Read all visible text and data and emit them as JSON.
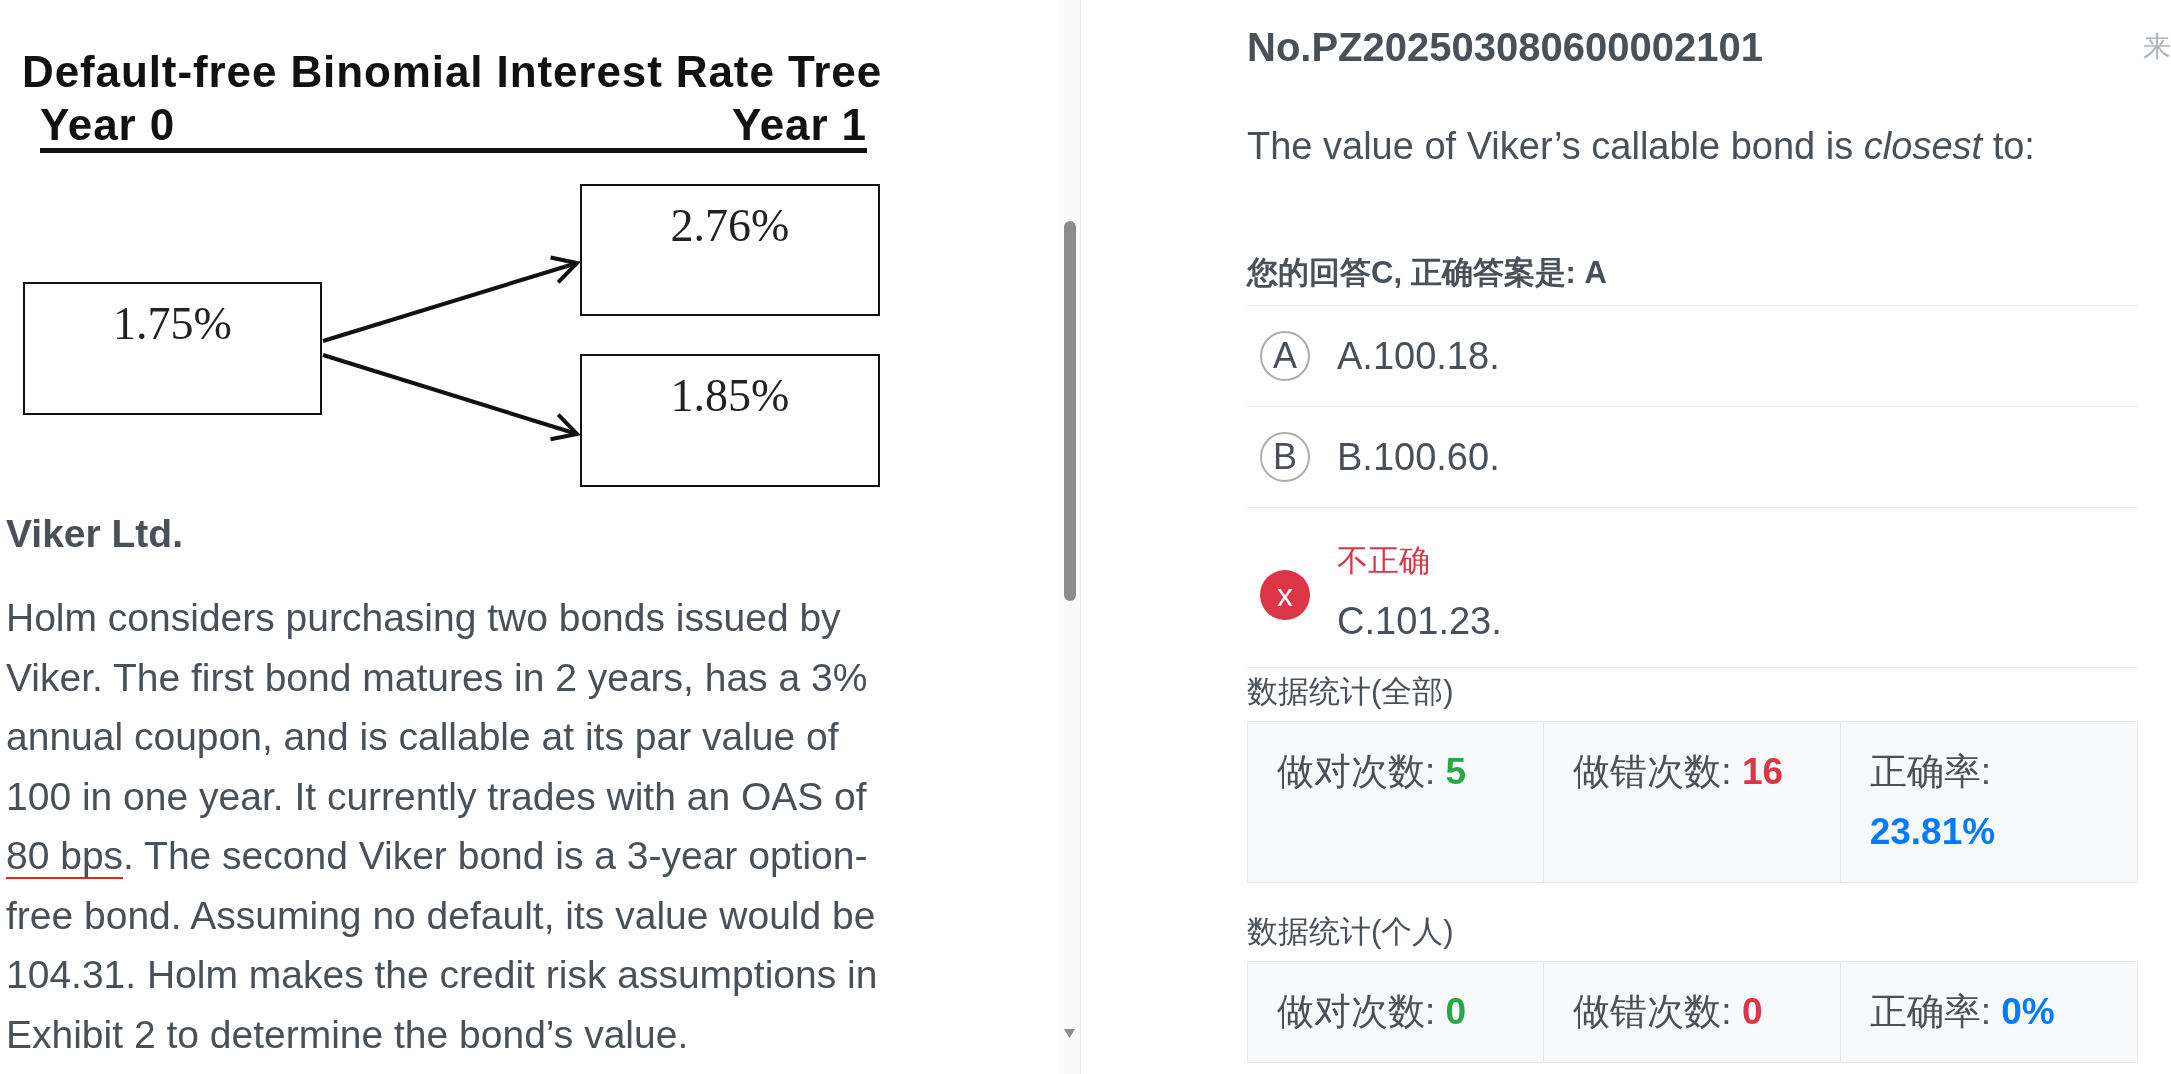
{
  "exhibit": {
    "title": "Default-free Binomial Interest Rate Tree",
    "year_labels": [
      "Year 0",
      "Year 1"
    ],
    "nodes": [
      {
        "value": "1.75%"
      },
      {
        "value": "2.76%"
      },
      {
        "value": "1.85%"
      }
    ]
  },
  "case": {
    "heading": "Viker Ltd.",
    "paragraph": [
      {
        "text": "Holm considers purchasing two bonds issued by Viker. The first bond matures in 2 years, has a 3% annual coupon, and is callable at its par value of 100 in one year. It currently trades with an OAS of ",
        "underlined": false
      },
      {
        "text": "80 bps",
        "underlined": true
      },
      {
        "text": ". The second Viker bond is a 3-year option-free bond. Assuming no default, its value would be 104.31. Holm makes the credit risk assumptions in Exhibit 2 to determine the bond’s value.",
        "underlined": false
      }
    ]
  },
  "question": {
    "number": "No.PZ202503080600002101",
    "side_label": "来",
    "prompt": "The value of Viker’s callable bond is *closest* to:",
    "answer_summary": "您的回答C, 正确答案是: A"
  },
  "options": [
    {
      "marker": "A",
      "text": "A.100.18.",
      "selected": false
    },
    {
      "marker": "B",
      "text": "B.100.60.",
      "selected": false
    },
    {
      "marker": "x",
      "text": "C.101.23.",
      "selected": true,
      "verdict": "不正确"
    }
  ],
  "stats": [
    {
      "heading": "数据统计(全部)",
      "items": [
        {
          "label": "做对次数:",
          "value": "5",
          "kind": "correct"
        },
        {
          "label": "做错次数:",
          "value": "16",
          "kind": "wrong"
        },
        {
          "label": "正确率:",
          "value": "23.81%",
          "kind": "rate"
        }
      ]
    },
    {
      "heading": "数据统计(个人)",
      "items": [
        {
          "label": "做对次数:",
          "value": "0",
          "kind": "correct"
        },
        {
          "label": "做错次数:",
          "value": "0",
          "kind": "wrong"
        },
        {
          "label": "正确率:",
          "value": "0%",
          "kind": "rate"
        }
      ]
    }
  ]
}
